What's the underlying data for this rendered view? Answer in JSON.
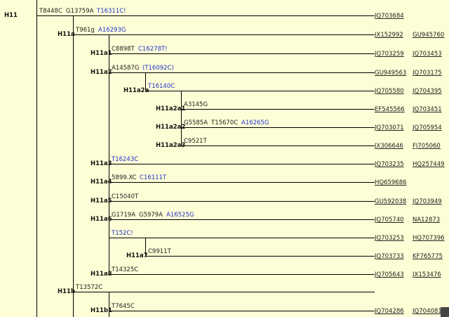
{
  "colors": {
    "background": "#fdfdd6",
    "back_mutation": "#2233cc",
    "line": "#000000"
  },
  "nodes": [
    {
      "id": "H11",
      "label": "H11",
      "mutations": [
        {
          "text": "T8448C",
          "blue": false
        },
        {
          "text": "G13759A",
          "blue": false
        },
        {
          "text": "T16311C!",
          "blue": true
        }
      ],
      "accessions": [
        "JQ703684"
      ]
    },
    {
      "id": "H11a",
      "label": "H11a",
      "mutations": [
        {
          "text": "T961g",
          "blue": false
        },
        {
          "text": "A16293G",
          "blue": true
        }
      ],
      "accessions": [
        "JX152992",
        "GU945760"
      ]
    },
    {
      "id": "H11a1",
      "label": "H11a1",
      "mutations": [
        {
          "text": "C8898T",
          "blue": false
        },
        {
          "text": "C16278T!",
          "blue": true
        }
      ],
      "accessions": [
        "JQ703259",
        "JQ703453"
      ]
    },
    {
      "id": "H11a2",
      "label": "H11a2",
      "mutations": [
        {
          "text": "A14587G",
          "blue": false
        },
        {
          "text": "(T16092C)",
          "blue": true
        }
      ],
      "accessions": [
        "GU949563",
        "JQ703175"
      ]
    },
    {
      "id": "H11a2a",
      "label": "H11a2a",
      "mutations": [
        {
          "text": "T16140C",
          "blue": true
        }
      ],
      "accessions": [
        "JQ705580",
        "JQ704395"
      ]
    },
    {
      "id": "H11a2a1",
      "label": "H11a2a1",
      "mutations": [
        {
          "text": "A3145G",
          "blue": false
        }
      ],
      "accessions": [
        "EF545566",
        "JQ703451"
      ]
    },
    {
      "id": "H11a2a2",
      "label": "H11a2a2",
      "mutations": [
        {
          "text": "G5585A",
          "blue": false
        },
        {
          "text": "T15670C",
          "blue": false
        },
        {
          "text": "A16265G",
          "blue": true
        }
      ],
      "accessions": [
        "JQ703071",
        "JQ705954"
      ]
    },
    {
      "id": "H11a2a3",
      "label": "H11a2a3",
      "mutations": [
        {
          "text": "C9521T",
          "blue": false
        }
      ],
      "accessions": [
        "JX306646",
        "FJ705060"
      ]
    },
    {
      "id": "H11a3",
      "label": "H11a3",
      "mutations": [
        {
          "text": "T16243C",
          "blue": true
        }
      ],
      "accessions": [
        "JQ703235",
        "HQ257449"
      ]
    },
    {
      "id": "H11a4",
      "label": "H11a4",
      "mutations": [
        {
          "text": "5899.XC",
          "blue": false
        },
        {
          "text": "C16111T",
          "blue": true
        }
      ],
      "accessions": [
        "HQ659686"
      ]
    },
    {
      "id": "H11a5",
      "label": "H11a5",
      "mutations": [
        {
          "text": "C15040T",
          "blue": false
        }
      ],
      "accessions": [
        "GU592038",
        "JQ703949"
      ]
    },
    {
      "id": "H11a6",
      "label": "H11a6",
      "mutations": [
        {
          "text": "G1719A",
          "blue": false
        },
        {
          "text": "G5979A",
          "blue": false
        },
        {
          "text": "A16525G",
          "blue": true
        }
      ],
      "accessions": [
        "JQ705740",
        "NA12873"
      ]
    },
    {
      "id": "H11a6sub",
      "label": "",
      "mutations": [
        {
          "text": "T152C!",
          "blue": true
        }
      ],
      "accessions": [
        "JQ703253",
        "HQ707396"
      ]
    },
    {
      "id": "H11a7",
      "label": "H11a7",
      "mutations": [
        {
          "text": "C9911T",
          "blue": false
        }
      ],
      "accessions": [
        "JQ703733",
        "KF765775"
      ]
    },
    {
      "id": "H11a8",
      "label": "H11a8",
      "mutations": [
        {
          "text": "T14325C",
          "blue": false
        }
      ],
      "accessions": [
        "JQ705643",
        "JX153476"
      ]
    },
    {
      "id": "H11b",
      "label": "H11b",
      "mutations": [
        {
          "text": "T13572C",
          "blue": false
        }
      ],
      "accessions": []
    },
    {
      "id": "H11b1",
      "label": "H11b1",
      "mutations": [
        {
          "text": "T7645C",
          "blue": false
        }
      ],
      "accessions": [
        "JQ704286",
        "JQ704081"
      ]
    }
  ]
}
